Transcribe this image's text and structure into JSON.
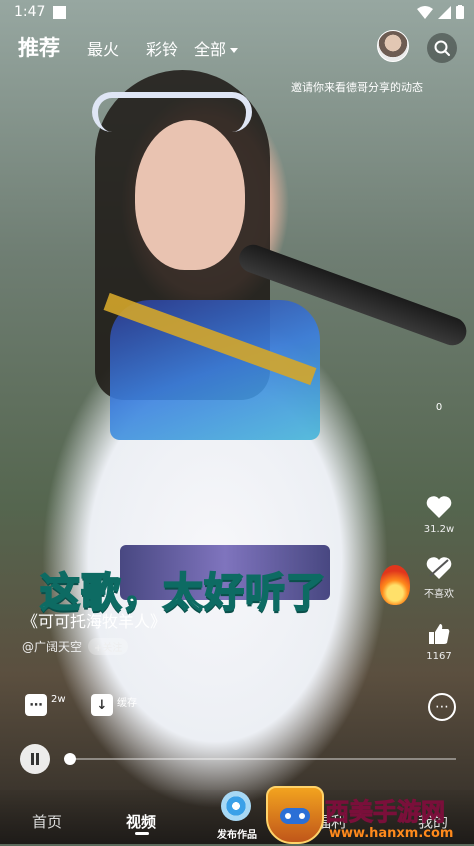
{
  "status_bar": {
    "time": "1:47"
  },
  "top_tabs": [
    {
      "label": "推荐",
      "active": true
    },
    {
      "label": "最火",
      "active": false
    },
    {
      "label": "彩铃",
      "active": false
    },
    {
      "label": "全部",
      "active": false
    }
  ],
  "share_hint": "邀请你来看德哥分享的动态",
  "side_actions": {
    "top_count": "0",
    "like_count": "31.2w",
    "dislike_label": "不喜欢",
    "thumb_count": "1167"
  },
  "video": {
    "caption": "这歌，太好听了",
    "song_title": "《可可托海牧羊人》",
    "author": "@广阔天空",
    "follow_label": "+关注"
  },
  "actions": {
    "comment_count": "2w",
    "download_label": "缓存",
    "more_icon": "more-icon"
  },
  "player": {
    "progress": 0.0
  },
  "bottom_nav": [
    {
      "label": "首页",
      "active": false
    },
    {
      "label": "视频",
      "active": true
    },
    {
      "label": "发布作品",
      "active": false
    },
    {
      "label": "福利",
      "active": false
    },
    {
      "label": "我的",
      "active": false
    }
  ],
  "watermark": {
    "title": "西美手游网",
    "url": "www.hanxm.com"
  }
}
